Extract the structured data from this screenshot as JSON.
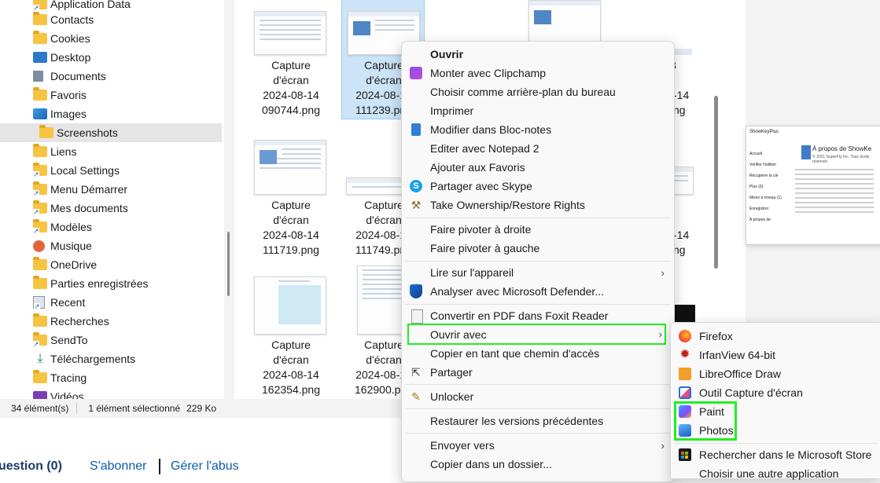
{
  "nav": {
    "items": [
      {
        "label": "Application Data",
        "icon": "folder-shortcut-icon"
      },
      {
        "label": "Contacts",
        "icon": "folder-icon"
      },
      {
        "label": "Cookies",
        "icon": "folder-icon"
      },
      {
        "label": "Desktop",
        "icon": "desktop-icon"
      },
      {
        "label": "Documents",
        "icon": "documents-icon"
      },
      {
        "label": "Favoris",
        "icon": "folder-icon"
      },
      {
        "label": "Images",
        "icon": "images-icon"
      },
      {
        "label": "Screenshots",
        "icon": "folder-icon",
        "selected": true
      },
      {
        "label": "Liens",
        "icon": "folder-icon"
      },
      {
        "label": "Local Settings",
        "icon": "folder-shortcut-icon"
      },
      {
        "label": "Menu Démarrer",
        "icon": "folder-shortcut-icon"
      },
      {
        "label": "Mes documents",
        "icon": "folder-shortcut-icon"
      },
      {
        "label": "Modèles",
        "icon": "folder-shortcut-icon"
      },
      {
        "label": "Musique",
        "icon": "music-icon"
      },
      {
        "label": "OneDrive",
        "icon": "folder-icon"
      },
      {
        "label": "Parties enregistrées",
        "icon": "folder-icon"
      },
      {
        "label": "Recent",
        "icon": "recent-icon"
      },
      {
        "label": "Recherches",
        "icon": "folder-icon"
      },
      {
        "label": "SendTo",
        "icon": "folder-shortcut-icon"
      },
      {
        "label": "Téléchargements",
        "icon": "download-icon"
      },
      {
        "label": "Tracing",
        "icon": "folder-icon"
      },
      {
        "label": "Vidéos",
        "icon": "videos-icon"
      }
    ]
  },
  "files": [
    {
      "label": "Capture\nd'écran\n2024-08-14\n090744.png"
    },
    {
      "label": "Capture\nd'écran\n2024-08-14\n111239.png",
      "selected": true
    },
    {
      "label": "Capture\nd'écran\n2024-08-14\n111719.png"
    },
    {
      "label": "Capture\nd'écran\n2024-08-14\n111749.png"
    },
    {
      "label": "Capture\nd'écran\n2024-08-14\n162354.png"
    },
    {
      "label": "Capture\nd'écran\n2024-08-14\n162900.png"
    }
  ],
  "partial_labels": {
    "r1_a": "8",
    "r1_b": "-14",
    "r1_c": "ng",
    "r2_b": "-14",
    "r2_c": "ng"
  },
  "preview": {
    "app": "ShowKeyPlus",
    "title": "À propos de ShowKe",
    "menu": [
      "Accueil",
      "Vérifier l'édition",
      "Récupérer la clé",
      "Plus (0)",
      "Mises à niveau (1)",
      "Enregistrer",
      "À propos de"
    ],
    "copyright": "© 2021 SuperFly Inc. Tous droits réservés"
  },
  "status": {
    "count": "34 élément(s)",
    "selected": "1 élément sélectionné",
    "size": "229 Ko"
  },
  "web": {
    "question": "uestion (0)",
    "subscribe": "S'abonner",
    "report": "Gérer l'abus"
  },
  "context_menu": {
    "items": [
      {
        "label": "Ouvrir",
        "icon": "",
        "bold": true
      },
      {
        "label": "Monter avec Clipchamp",
        "icon": "clipchamp-icon"
      },
      {
        "label": "Choisir comme arrière-plan du bureau",
        "icon": ""
      },
      {
        "label": "Imprimer",
        "icon": ""
      },
      {
        "label": "Modifier dans Bloc-notes",
        "icon": "notepad-icon"
      },
      {
        "label": "Editer avec Notepad 2",
        "icon": ""
      },
      {
        "label": "Ajouter aux Favoris",
        "icon": ""
      },
      {
        "label": "Partager avec Skype",
        "icon": "skype-icon"
      },
      {
        "label": "Take Ownership/Restore Rights",
        "icon": "ownership-icon"
      },
      {
        "label": "Faire pivoter à droite",
        "icon": ""
      },
      {
        "label": "Faire pivoter à gauche",
        "icon": ""
      },
      {
        "label": "Lire sur l'appareil",
        "icon": "",
        "submenu": true
      },
      {
        "label": "Analyser avec Microsoft Defender...",
        "icon": "defender-icon"
      },
      {
        "label": "Convertir en PDF dans Foxit Reader",
        "icon": "foxit-icon"
      },
      {
        "label": "Ouvrir avec",
        "icon": "",
        "submenu": true,
        "highlighted": true
      },
      {
        "label": "Copier en tant que chemin d'accès",
        "icon": ""
      },
      {
        "label": "Partager",
        "icon": "share-icon"
      },
      {
        "label": "Unlocker",
        "icon": "unlocker-icon"
      },
      {
        "label": "Restaurer les versions précédentes",
        "icon": ""
      },
      {
        "label": "Envoyer vers",
        "icon": "",
        "submenu": true
      },
      {
        "label": "Copier dans un dossier...",
        "icon": ""
      }
    ]
  },
  "open_with": {
    "items": [
      {
        "label": "Firefox",
        "icon": "firefox-icon"
      },
      {
        "label": "IrfanView 64-bit",
        "icon": "irfanview-icon"
      },
      {
        "label": "LibreOffice Draw",
        "icon": "libreoffice-draw-icon"
      },
      {
        "label": "Outil Capture d'écran",
        "icon": "snipping-tool-icon"
      },
      {
        "label": "Paint",
        "icon": "paint-icon"
      },
      {
        "label": "Photos",
        "icon": "photos-icon"
      },
      {
        "label": "Rechercher dans le Microsoft Store",
        "icon": "store-icon"
      },
      {
        "label": "Choisir une autre application",
        "icon": ""
      }
    ]
  },
  "colors": {
    "highlight": "#22ee22",
    "accent": "#0a5db0",
    "selection": "#cce4f7"
  }
}
